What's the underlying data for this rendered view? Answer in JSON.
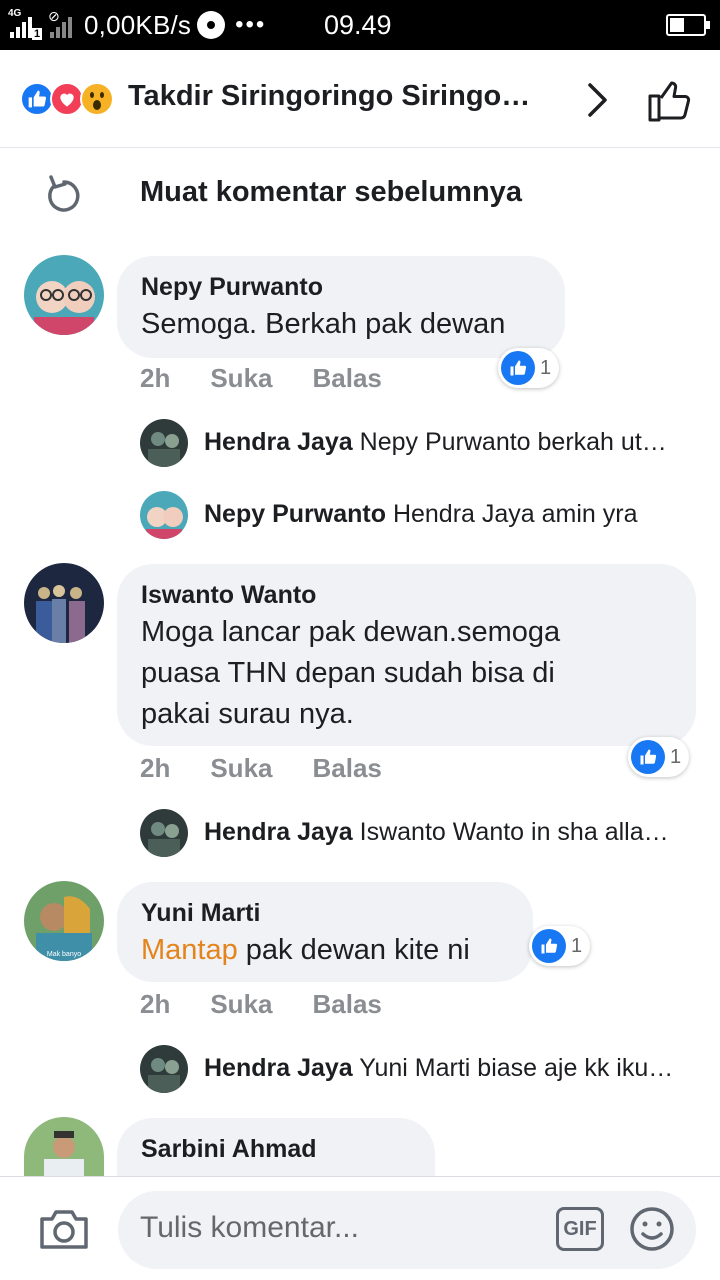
{
  "status_bar": {
    "network": "4G",
    "sim": "1",
    "speed": "0,00KB/s",
    "more": "•••",
    "time": "09.49",
    "battery_level": 0.45
  },
  "header": {
    "reactions": [
      "like-icon",
      "love-icon",
      "wow-icon"
    ],
    "title": "Takdir Siringoringo Siringo…"
  },
  "load_more": {
    "label": "Muat komentar sebelumnya"
  },
  "comments": [
    {
      "author": "Nepy Purwanto",
      "text": "Semoga. Berkah pak dewan",
      "time": "2h",
      "like": "Suka",
      "reply": "Balas",
      "likes": "1",
      "replies": [
        {
          "author": "Hendra Jaya",
          "text": "Nepy Purwanto berkah ut…"
        },
        {
          "author": "Nepy Purwanto",
          "text": "Hendra Jaya amin yra"
        }
      ]
    },
    {
      "author": "Iswanto Wanto",
      "text": "Moga lancar pak dewan.semoga puasa  THN depan sudah bisa di pakai surau nya.",
      "text_lines": [
        "Moga lancar pak dewan.semoga",
        "puasa  THN depan sudah bisa di",
        "pakai surau nya."
      ],
      "time": "2h",
      "like": "Suka",
      "reply": "Balas",
      "likes": "1",
      "replies": [
        {
          "author": "Hendra Jaya",
          "text": "Iswanto Wanto in sha alla…"
        }
      ]
    },
    {
      "author": "Yuni Marti",
      "text_highlight": "Mantap",
      "text_rest": " pak dewan kite ni",
      "time": "2h",
      "like": "Suka",
      "reply": "Balas",
      "likes": "1",
      "avatar_caption": "Mak banyo",
      "replies": [
        {
          "author": "Hendra Jaya",
          "text": "Yuni Marti biase aje kk iku…"
        }
      ]
    },
    {
      "author": "Sarbini Ahmad"
    }
  ],
  "composer": {
    "placeholder": "Tulis komentar...",
    "gif_label": "GIF"
  },
  "colors": {
    "like_blue": "#1877f2",
    "love_red": "#f33e58",
    "wow_yellow": "#f7b125",
    "bubble_gray": "#f0f2f5",
    "meta_gray": "#8a8d91",
    "mention_orange": "#e3841c"
  }
}
